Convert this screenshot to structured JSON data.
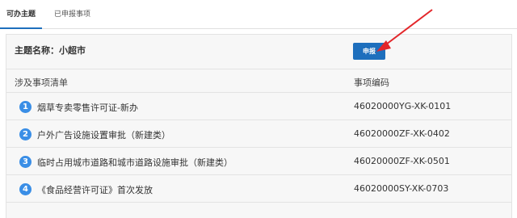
{
  "tabs": [
    {
      "label": "可办主题"
    },
    {
      "label": "已申报事项"
    }
  ],
  "theme": {
    "label": "主题名称：小超市"
  },
  "apply_button": {
    "label": "申报"
  },
  "table": {
    "headers": [
      "涉及事项清单",
      "事项编码"
    ],
    "rows": [
      {
        "num": "1",
        "name": "烟草专卖零售许可证-新办",
        "code": "46020000YG-XK-0101"
      },
      {
        "num": "2",
        "name": "户外广告设施设置审批（新建类）",
        "code": "46020000ZF-XK-0402"
      },
      {
        "num": "3",
        "name": "临时占用城市道路和城市道路设施审批（新建类）",
        "code": "46020000ZF-XK-0501"
      },
      {
        "num": "4",
        "name": "《食品经营许可证》首次发放",
        "code": "46020000SY-XK-0703"
      }
    ]
  },
  "colors": {
    "accent": "#1e6fbd",
    "badge": "#3a8ee6",
    "arrow": "#e3262a"
  }
}
